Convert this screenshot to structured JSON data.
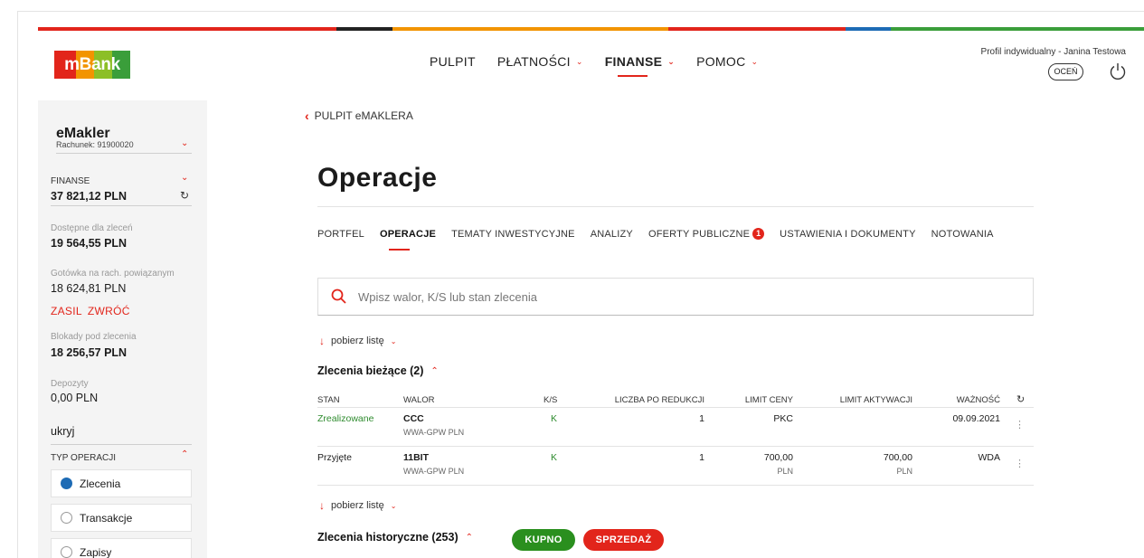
{
  "brand": {
    "logo_text": "mBank",
    "colors": {
      "red": "#e2251b",
      "orange": "#f29400",
      "green": "#2a8f1e",
      "blue": "#1d6bb5"
    },
    "color_bar": [
      "#e2251b",
      "#222222",
      "#f29400",
      "#e2251b",
      "#1d6bb5",
      "#3a9e3a"
    ]
  },
  "topnav": {
    "items": [
      {
        "label": "PULPIT",
        "has_menu": false
      },
      {
        "label": "PŁATNOŚCI",
        "has_menu": true
      },
      {
        "label": "FINANSE",
        "has_menu": true,
        "active": true
      },
      {
        "label": "POMOC",
        "has_menu": true
      }
    ]
  },
  "profile": {
    "text": "Profil indywidualny - Janina Testowa",
    "rate_label": "OCEŃ"
  },
  "sidebar": {
    "account_title": "eMakler",
    "account_sub": "Rachunek: 91900020",
    "finanse_label": "FINANSE",
    "finanse_value": "37 821,12 PLN",
    "available_label": "Dostępne dla zleceń",
    "available_value": "19 564,55 PLN",
    "cash_label": "Gotówka na rach. powiązanym",
    "cash_value": "18 624,81 PLN",
    "link_topup": "ZASIL",
    "link_return": "ZWRÓĆ",
    "blocked_label": "Blokady pod zlecenia",
    "blocked_value": "18 256,57 PLN",
    "deposits_label": "Depozyty",
    "deposits_value": "0,00 PLN",
    "hide_label": "ukryj",
    "op_type_label": "TYP OPERACJI",
    "op_options": [
      "Zlecenia",
      "Transakcje",
      "Zapisy"
    ]
  },
  "breadcrumb": {
    "label": "PULPIT eMAKLERA"
  },
  "page": {
    "title": "Operacje"
  },
  "tabs": [
    {
      "label": "PORTFEL"
    },
    {
      "label": "OPERACJE",
      "active": true
    },
    {
      "label": "TEMATY INWESTYCYJNE"
    },
    {
      "label": "ANALIZY"
    },
    {
      "label": "OFERTY PUBLICZNE",
      "badge": "1"
    },
    {
      "label": "USTAWIENIA I DOKUMENTY"
    },
    {
      "label": "NOTOWANIA"
    }
  ],
  "search": {
    "placeholder": "Wpisz walor, K/S lub stan zlecenia"
  },
  "download_label": "pobierz listę",
  "current_orders": {
    "title": "Zlecenia bieżące (2)",
    "columns": {
      "stan": "STAN",
      "walor": "WALOR",
      "ks": "K/S",
      "liczba": "LICZBA PO REDUKCJI",
      "limit_ceny": "LIMIT CENY",
      "limit_aktywacji": "LIMIT AKTYWACJI",
      "waznosc": "WAŻNOŚĆ"
    },
    "rows": [
      {
        "stan": "Zrealizowane",
        "walor": "CCC",
        "market": "WWA-GPW PLN",
        "ks": "K",
        "liczba": "1",
        "limit_ceny": "PKC",
        "limit_ceny_cur": "",
        "limit_aktywacji": "",
        "limit_aktywacji_cur": "",
        "waznosc": "09.09.2021"
      },
      {
        "stan": "Przyjęte",
        "walor": "11BIT",
        "market": "WWA-GPW PLN",
        "ks": "K",
        "liczba": "1",
        "limit_ceny": "700,00",
        "limit_ceny_cur": "PLN",
        "limit_aktywacji": "700,00",
        "limit_aktywacji_cur": "PLN",
        "waznosc": "WDA"
      }
    ]
  },
  "history_orders": {
    "title": "Zlecenia historyczne (253)"
  },
  "buttons": {
    "buy": "KUPNO",
    "sell": "SPRZEDAŻ"
  }
}
